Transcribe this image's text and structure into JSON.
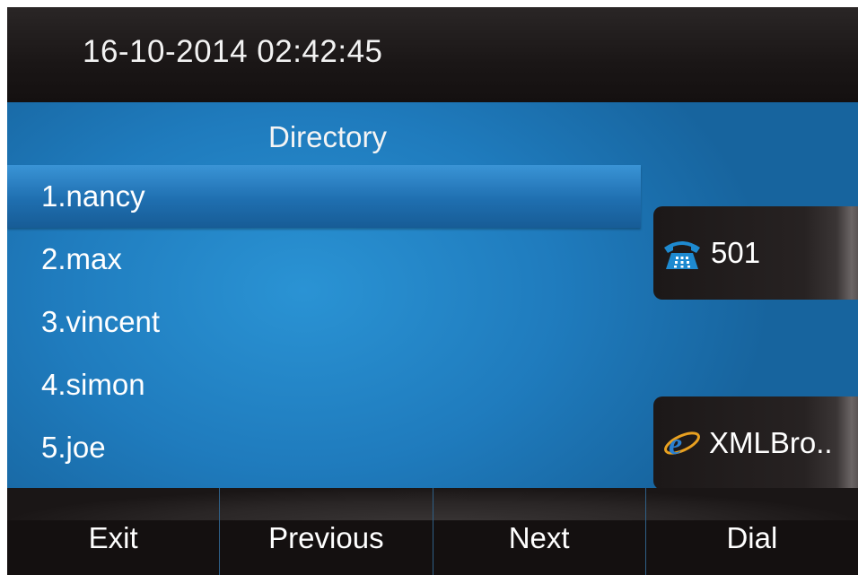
{
  "status_bar": {
    "datetime": "16-10-2014 02:42:45"
  },
  "directory": {
    "title": "Directory",
    "entries": [
      "1.nancy",
      "2.max",
      "3.vincent",
      "4.simon",
      "5.joe"
    ],
    "selected_index": 0
  },
  "side_buttons": {
    "line": {
      "icon": "phone-icon",
      "label": "501"
    },
    "browser": {
      "icon": "browser-icon",
      "label": "XMLBro.."
    }
  },
  "softkeys": {
    "exit": "Exit",
    "previous": "Previous",
    "next": "Next",
    "dial": "Dial"
  },
  "colors": {
    "accent": "#1e74b4",
    "bar": "#1a1616",
    "icon": "#1e8ad0"
  }
}
